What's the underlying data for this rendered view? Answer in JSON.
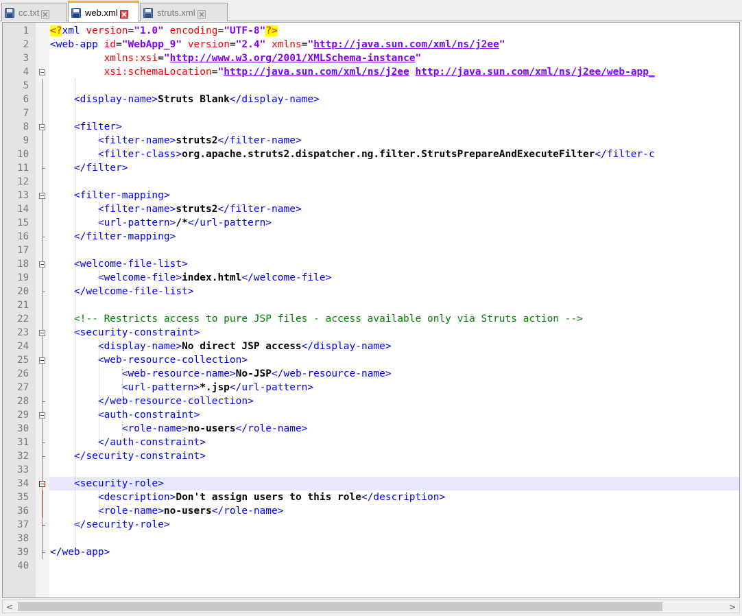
{
  "tabs": [
    {
      "name": "cc.txt",
      "active": false,
      "icon": "save-disk-icon"
    },
    {
      "name": "web.xml",
      "active": true,
      "icon": "save-disk-icon"
    },
    {
      "name": "struts.xml",
      "active": false,
      "icon": "save-disk-icon"
    }
  ],
  "editor": {
    "current_line": 34,
    "lines": [
      [
        [
          "pi",
          "<?"
        ],
        [
          "t",
          "xml "
        ],
        [
          "a",
          "version"
        ],
        [
          "q",
          "="
        ],
        [
          "v",
          "\"1.0\""
        ],
        [
          "q",
          " "
        ],
        [
          "a",
          "encoding"
        ],
        [
          "q",
          "="
        ],
        [
          "v",
          "\"UTF-8\""
        ],
        [
          "pi",
          "?>"
        ]
      ],
      [
        [
          "t",
          "<web-app "
        ],
        [
          "a",
          "id"
        ],
        [
          "q",
          "="
        ],
        [
          "v",
          "\"WebApp_9\""
        ],
        [
          "q",
          " "
        ],
        [
          "a",
          "version"
        ],
        [
          "q",
          "="
        ],
        [
          "v",
          "\"2.4\""
        ],
        [
          "q",
          " "
        ],
        [
          "a",
          "xmlns"
        ],
        [
          "q",
          "="
        ],
        [
          "v",
          "\""
        ],
        [
          "u",
          "http://java.sun.com/xml/ns/j2ee"
        ],
        [
          "v",
          "\""
        ]
      ],
      [
        [
          "q",
          "         "
        ],
        [
          "a",
          "xmlns:xsi"
        ],
        [
          "q",
          "="
        ],
        [
          "v",
          "\""
        ],
        [
          "u",
          "http://www.w3.org/2001/XMLSchema-instance"
        ],
        [
          "v",
          "\""
        ]
      ],
      [
        [
          "q",
          "         "
        ],
        [
          "a",
          "xsi:schemaLocation"
        ],
        [
          "q",
          "="
        ],
        [
          "v",
          "\""
        ],
        [
          "u",
          "http://java.sun.com/xml/ns/j2ee"
        ],
        [
          "q",
          " "
        ],
        [
          "u",
          "http://java.sun.com/xml/ns/j2ee/web-app_"
        ]
      ],
      [],
      [
        [
          "q",
          "    "
        ],
        [
          "t",
          "<display-name>"
        ],
        [
          "x",
          "Struts Blank"
        ],
        [
          "t",
          "</display-name>"
        ]
      ],
      [],
      [
        [
          "q",
          "    "
        ],
        [
          "t",
          "<filter>"
        ]
      ],
      [
        [
          "q",
          "        "
        ],
        [
          "t",
          "<filter-name>"
        ],
        [
          "x",
          "struts2"
        ],
        [
          "t",
          "</filter-name>"
        ]
      ],
      [
        [
          "q",
          "        "
        ],
        [
          "t",
          "<filter-class>"
        ],
        [
          "x",
          "org.apache.struts2.dispatcher.ng.filter.StrutsPrepareAndExecuteFilter"
        ],
        [
          "t",
          "</filter-c"
        ]
      ],
      [
        [
          "q",
          "    "
        ],
        [
          "t",
          "</filter>"
        ]
      ],
      [],
      [
        [
          "q",
          "    "
        ],
        [
          "t",
          "<filter-mapping>"
        ]
      ],
      [
        [
          "q",
          "        "
        ],
        [
          "t",
          "<filter-name>"
        ],
        [
          "x",
          "struts2"
        ],
        [
          "t",
          "</filter-name>"
        ]
      ],
      [
        [
          "q",
          "        "
        ],
        [
          "t",
          "<url-pattern>"
        ],
        [
          "x",
          "/*"
        ],
        [
          "t",
          "</url-pattern>"
        ]
      ],
      [
        [
          "q",
          "    "
        ],
        [
          "t",
          "</filter-mapping>"
        ]
      ],
      [],
      [
        [
          "q",
          "    "
        ],
        [
          "t",
          "<welcome-file-list>"
        ]
      ],
      [
        [
          "q",
          "        "
        ],
        [
          "t",
          "<welcome-file>"
        ],
        [
          "x",
          "index.html"
        ],
        [
          "t",
          "</welcome-file>"
        ]
      ],
      [
        [
          "q",
          "    "
        ],
        [
          "t",
          "</welcome-file-list>"
        ]
      ],
      [],
      [
        [
          "q",
          "    "
        ],
        [
          "c",
          "<!-- Restricts access to pure JSP files - access available only via Struts action -->"
        ]
      ],
      [
        [
          "q",
          "    "
        ],
        [
          "t",
          "<security-constraint>"
        ]
      ],
      [
        [
          "q",
          "        "
        ],
        [
          "t",
          "<display-name>"
        ],
        [
          "x",
          "No direct JSP access"
        ],
        [
          "t",
          "</display-name>"
        ]
      ],
      [
        [
          "q",
          "        "
        ],
        [
          "t",
          "<web-resource-collection>"
        ]
      ],
      [
        [
          "q",
          "            "
        ],
        [
          "t",
          "<web-resource-name>"
        ],
        [
          "x",
          "No-JSP"
        ],
        [
          "t",
          "</web-resource-name>"
        ]
      ],
      [
        [
          "q",
          "            "
        ],
        [
          "t",
          "<url-pattern>"
        ],
        [
          "x",
          "*.jsp"
        ],
        [
          "t",
          "</url-pattern>"
        ]
      ],
      [
        [
          "q",
          "        "
        ],
        [
          "t",
          "</web-resource-collection>"
        ]
      ],
      [
        [
          "q",
          "        "
        ],
        [
          "t",
          "<auth-constraint>"
        ]
      ],
      [
        [
          "q",
          "            "
        ],
        [
          "t",
          "<role-name>"
        ],
        [
          "x",
          "no-users"
        ],
        [
          "t",
          "</role-name>"
        ]
      ],
      [
        [
          "q",
          "        "
        ],
        [
          "t",
          "</auth-constraint>"
        ]
      ],
      [
        [
          "q",
          "    "
        ],
        [
          "t",
          "</security-constraint>"
        ]
      ],
      [],
      [
        [
          "q",
          "    "
        ],
        [
          "t",
          "<security-role>"
        ]
      ],
      [
        [
          "q",
          "        "
        ],
        [
          "t",
          "<description>"
        ],
        [
          "x",
          "Don't assign users to this role"
        ],
        [
          "t",
          "</description>"
        ]
      ],
      [
        [
          "q",
          "        "
        ],
        [
          "t",
          "<role-name>"
        ],
        [
          "x",
          "no-users"
        ],
        [
          "t",
          "</role-name>"
        ]
      ],
      [
        [
          "q",
          "    "
        ],
        [
          "t",
          "</security-role>"
        ]
      ],
      [],
      [
        [
          "t",
          "</web-app>"
        ]
      ],
      []
    ]
  },
  "scrollbar": {
    "left_arrow": "<",
    "right_arrow": ">"
  },
  "colors": {
    "tag": "#0000ff",
    "attribute": "#ff0000",
    "value": "#8000ff",
    "comment": "#008000",
    "current_line": "#e8e8ff",
    "active_tab_accent": "#fab040"
  }
}
